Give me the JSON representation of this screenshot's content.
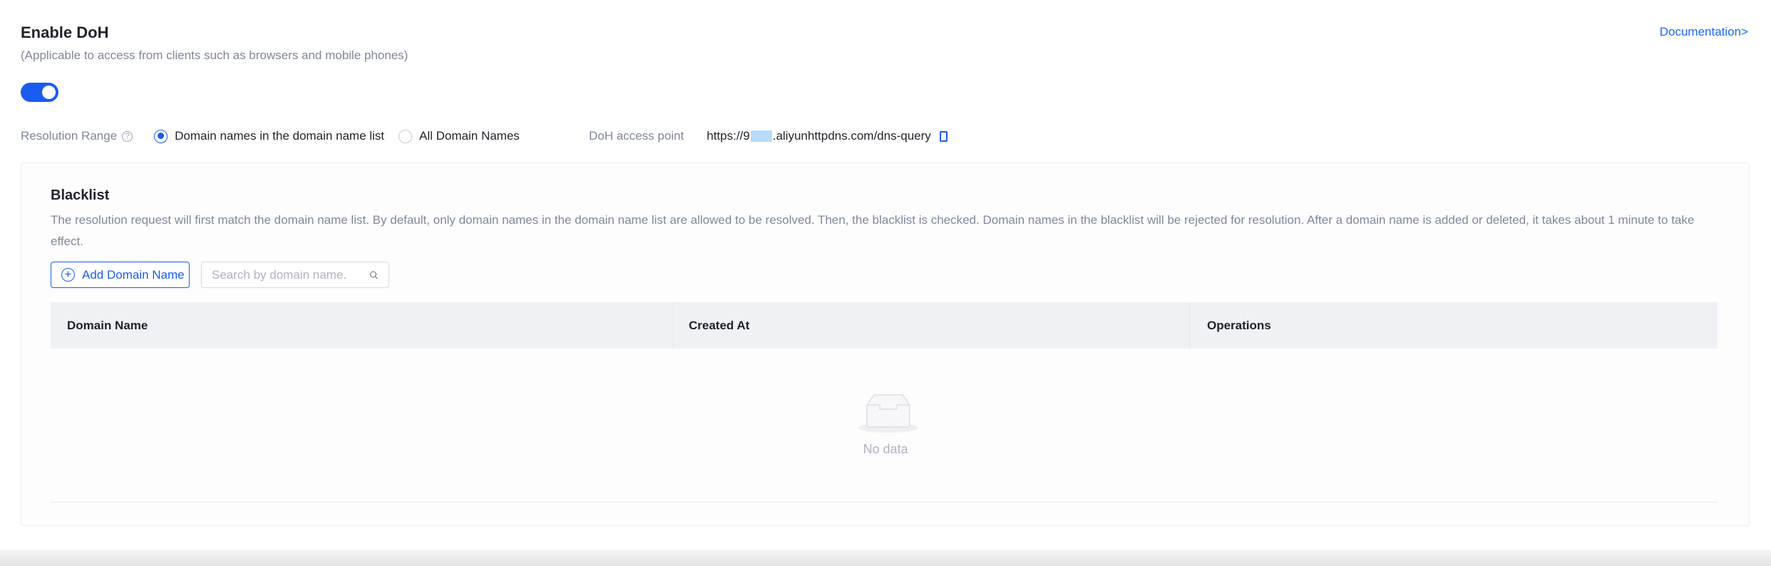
{
  "header": {
    "title": "Enable DoH",
    "subtitle": "(Applicable to access from clients such as browsers and mobile phones)",
    "doc_link": "Documentation>",
    "enabled": true
  },
  "resolution": {
    "label": "Resolution Range",
    "help": "?",
    "options": [
      {
        "label": "Domain names in the domain name list",
        "selected": true
      },
      {
        "label": "All Domain Names",
        "selected": false
      }
    ]
  },
  "access": {
    "label": "DoH access point",
    "url_prefix": "https://9",
    "url_suffix": ".aliyunhttpdns.com/dns-query"
  },
  "blacklist": {
    "title": "Blacklist",
    "description": "The resolution request will first match the domain name list. By default, only domain names in the domain name list are allowed to be resolved. Then, the blacklist is checked. Domain names in the blacklist will be rejected for resolution. After a domain name is added or deleted, it takes about 1 minute to take effect.",
    "add_button": "Add Domain Name",
    "search_placeholder": "Search by domain name.",
    "columns": [
      "Domain Name",
      "Created At",
      "Operations"
    ],
    "empty_text": "No data"
  },
  "colors": {
    "accent": "#1a5cf0"
  }
}
